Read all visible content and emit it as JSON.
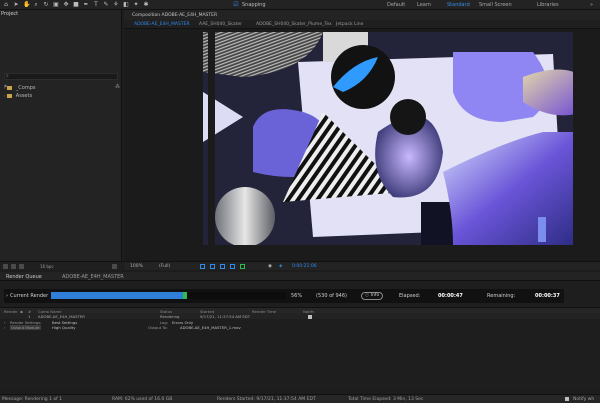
{
  "toolbar": {
    "snapping_label": "Snapping",
    "workspaces": [
      "Default",
      "Learn",
      "Standard",
      "Small Screen",
      "Libraries"
    ],
    "active_workspace_index": 2
  },
  "project": {
    "title": "Project",
    "tree": [
      "_Comps",
      "Assets"
    ],
    "footer_bpc": "16 bpc"
  },
  "composition": {
    "header": "Composition ADOBE-AE_E4H_MASTER",
    "tabs": [
      "ADOBE-AE_E4H_MASTER",
      "AAE_SH040_Skater",
      "ADOBE_SH040_Skater_Plume_Tex",
      "Jetpack Line"
    ],
    "active_tab_index": 0
  },
  "viewer_bar": {
    "zoom": "100%",
    "resolution": "(Full)",
    "timecode": "0:00:21:06"
  },
  "render_queue": {
    "tabs": [
      "Render Queue",
      "ADOBE-AE_E4H_MASTER"
    ],
    "current_render_label": "Current Render",
    "progress_percent": 56,
    "progress_label": "56%",
    "frames_label": "(530 of 946)",
    "info_label": "Info",
    "elapsed_label": "Elapsed:",
    "elapsed_value": "00:00:47",
    "remaining_label": "Remaining:",
    "remaining_value": "00:00:37",
    "columns": [
      "Render",
      "#",
      "Comp Name",
      "Status",
      "Started",
      "Render Time",
      "Notify"
    ],
    "row": {
      "index": "1",
      "comp_name": "ADOBE-AE_E4H_MASTER",
      "status": "Rendering",
      "started": "9/17/21, 11:37:54 AM EDT"
    },
    "render_settings_label": "Render Settings:",
    "render_settings_value": "Best Settings",
    "log_label": "Log:",
    "log_value": "Errors Only",
    "output_module_label": "Output Module:",
    "output_module_value": "High Quality",
    "output_to_label": "Output To:",
    "output_to_value": "ADOBE-AE_E4H_MASTER_1.mov"
  },
  "status_bar": {
    "message": "Message: Rendering 1 of 1",
    "ram": "RAM: 62% used of 16.0 GB",
    "renders_started": "Renders Started: 9/17/21, 11:37:54 AM EDT",
    "total_time": "Total Time Elapsed: 3 Min, 13 Sec",
    "notify": "Notify wh"
  },
  "colors": {
    "accent": "#2f8bf0",
    "progress": "#2f7ed8",
    "progress_tail": "#2dbd4e"
  }
}
